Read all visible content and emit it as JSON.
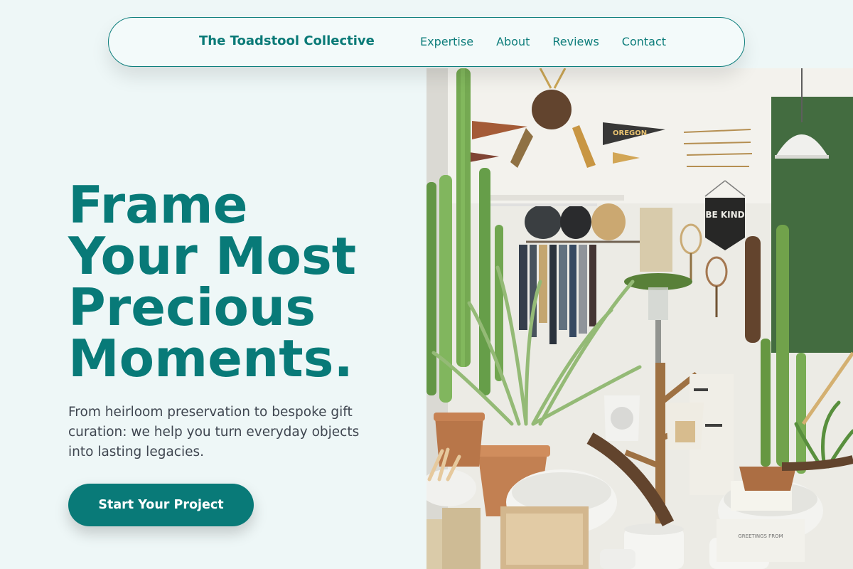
{
  "nav": {
    "brand": "The Toadstool Collective",
    "links": [
      "Expertise",
      "About",
      "Reviews",
      "Contact"
    ]
  },
  "hero": {
    "title_lines": [
      "Frame",
      "Your Most",
      "Precious",
      "Moments."
    ],
    "subtitle": "From heirloom preservation to bespoke gift curation: we help you turn everyday objects into lasting legacies.",
    "cta_label": "Start Your Project"
  },
  "photo": {
    "pennant_text": "OREGON",
    "banner_text": "BE KIND",
    "card_text": "GREETINGS FROM"
  },
  "colors": {
    "page_bg": "#eef7f7",
    "accent": "#087a78",
    "body_text": "#3f4650"
  }
}
